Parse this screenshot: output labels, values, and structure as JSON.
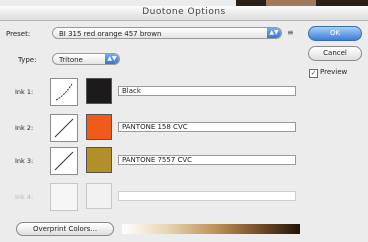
{
  "window": {
    "title": "Duotone Options"
  },
  "preset": {
    "label": "Preset:",
    "value": "BI 315 red orange 457 brown"
  },
  "type": {
    "label": "Type:",
    "value": "Tritone"
  },
  "inks": [
    {
      "label": "Ink 1:",
      "name": "Black",
      "color": "#1c1a1a",
      "enabled": true
    },
    {
      "label": "Ink 2:",
      "name": "PANTONE 158 CVC",
      "color": "#f05a1c",
      "enabled": true
    },
    {
      "label": "Ink 3:",
      "name": "PANTONE 7557 CVC",
      "color": "#b38f2a",
      "enabled": true
    },
    {
      "label": "Ink 4:",
      "name": "",
      "color": "#f2f2f2",
      "enabled": false
    }
  ],
  "buttons": {
    "ok": "OK",
    "cancel": "Cancel",
    "overprint": "Overprint Colors..."
  },
  "preview": {
    "label": "Preview",
    "checked": true
  },
  "icons": {
    "preset_menu": "preset-options-icon"
  },
  "colors": {
    "accent": "#3d7fd8"
  }
}
